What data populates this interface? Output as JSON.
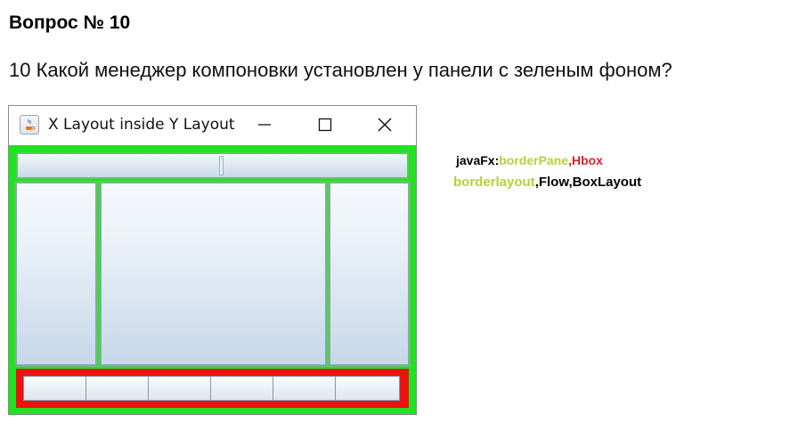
{
  "heading": "Вопрос № 10",
  "question": "10 Какой менеджер компоновки установлен у панели с зеленым фоном?",
  "window": {
    "title": "X Layout inside Y Layout",
    "icon": "java-cup-icon",
    "controls": {
      "minimize": "minimize-icon",
      "maximize": "maximize-icon",
      "close": "close-icon"
    },
    "colors": {
      "outer_panel": "#22e022",
      "south_panel": "#ee1111"
    },
    "south_button_count": 6
  },
  "notes": {
    "line1": {
      "prefix": "javaFx:",
      "item1": "borderPane",
      "sep": ",",
      "item2": "Hbox"
    },
    "line2": {
      "item1": "borderlayout",
      "rest": ",Flow,BoxLayout"
    },
    "colors": {
      "black": "#000000",
      "olive": "#b9cf3a",
      "red": "#d8222a"
    }
  }
}
